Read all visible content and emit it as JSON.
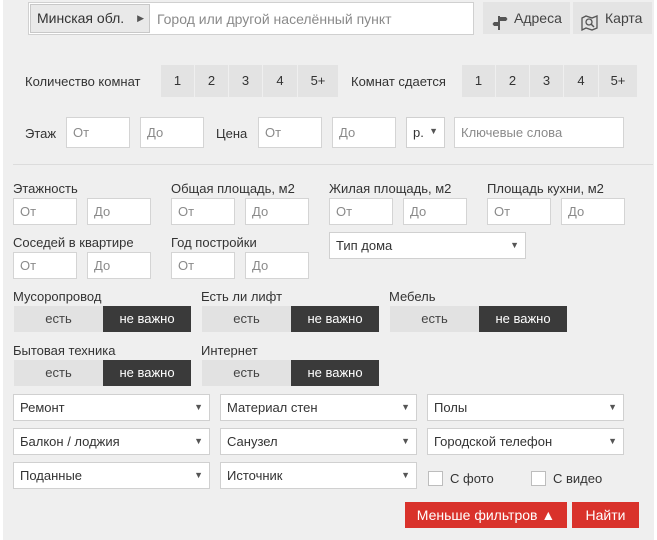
{
  "search": {
    "region": "Минская обл.",
    "city_placeholder": "Город или другой населённый пункт",
    "addresses_label": "Адреса",
    "map_label": "Карта"
  },
  "rooms": {
    "count_label": "Количество комнат",
    "rented_label": "Комнат сдается",
    "options": [
      "1",
      "2",
      "3",
      "4",
      "5+"
    ]
  },
  "floor": {
    "label": "Этаж",
    "from": "От",
    "to": "До"
  },
  "price": {
    "label": "Цена",
    "from": "От",
    "to": "До",
    "currency": "р."
  },
  "keywords_placeholder": "Ключевые слова",
  "ranges": {
    "storeys": "Этажность",
    "total_area": "Общая площадь, м2",
    "living_area": "Жилая площадь, м2",
    "kitchen_area": "Площадь кухни, м2",
    "neighbors": "Соседей в квартире",
    "year_built": "Год постройки",
    "from": "От",
    "to": "До"
  },
  "house_type": "Тип дома",
  "toggles": {
    "garbage_chute": "Мусоропровод",
    "elevator": "Есть ли лифт",
    "furniture": "Мебель",
    "appliances": "Бытовая техника",
    "internet": "Интернет",
    "yes": "есть",
    "any": "не важно"
  },
  "selects": {
    "renovation": "Ремонт",
    "wall_material": "Материал стен",
    "floors": "Полы",
    "balcony": "Балкон / лоджия",
    "bathroom": "Санузел",
    "phone": "Городской телефон",
    "submitted": "Поданные",
    "source": "Источник"
  },
  "checks": {
    "photo": "С фото",
    "video": "С видео"
  },
  "actions": {
    "less_filters": "Меньше фильтров ▲",
    "find": "Найти"
  }
}
